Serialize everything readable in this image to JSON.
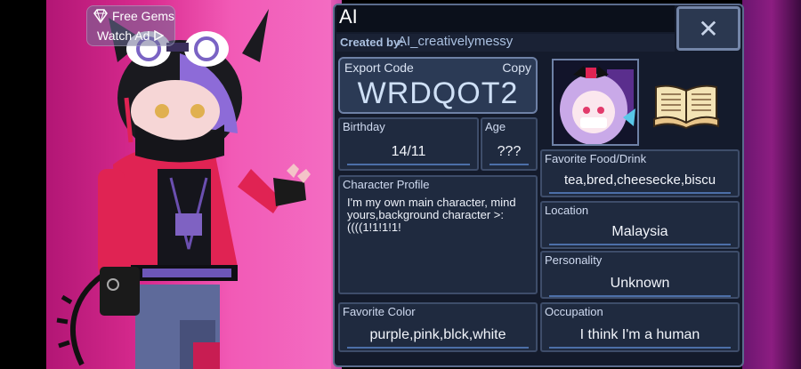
{
  "gems": {
    "label": "Free Gems",
    "ad_label": "Watch Ad"
  },
  "panel": {
    "title": "AI",
    "created_by_label": "Created by:",
    "created_by_value": "AI_creativelymessy",
    "export_code_label": "Export Code",
    "copy_label": "Copy",
    "export_code": "WRDQOT2"
  },
  "fields": {
    "birthday": {
      "label": "Birthday",
      "value": "14/11"
    },
    "age": {
      "label": "Age",
      "value": "???"
    },
    "food": {
      "label": "Favorite Food/Drink",
      "value": "tea,bred,cheesecke,biscu"
    },
    "profile": {
      "label": "Character Profile",
      "value": "I'm my own main character, mind yours,background character >:((((1!1!1!1!"
    },
    "location": {
      "label": "Location",
      "value": "Malaysia"
    },
    "personality": {
      "label": "Personality",
      "value": "Unknown"
    },
    "color": {
      "label": "Favorite Color",
      "value": "purple,pink,blck,white"
    },
    "occupation": {
      "label": "Occupation",
      "value": "I think I'm a human"
    }
  },
  "icons": {
    "gem": "diamond-icon",
    "play": "play-icon",
    "close": "close-icon",
    "book": "book-icon"
  },
  "colors": {
    "panel_bg": "#141b2c",
    "field_bg": "#1f2a3f",
    "accent_line": "#4c6fa8",
    "stage_pink": "#d92b8f"
  }
}
